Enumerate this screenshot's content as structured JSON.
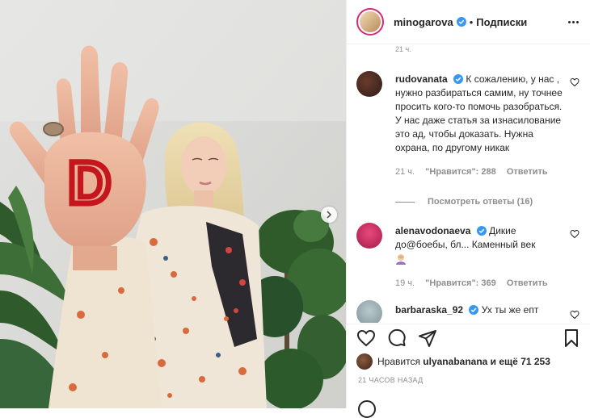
{
  "post": {
    "author": "minogarova",
    "follow_label": "Подписки",
    "separator": "•",
    "time_ago": "21 ЧАСОВ НАЗАД",
    "cut_top_time": "21 ч."
  },
  "comments": [
    {
      "user": "rudovanata",
      "verified": true,
      "text": "К сожалению, у нас , нужно разбираться самим, ну точнее просить кого-то помочь разобраться. У нас даже статья за изнасилование это ад, чтобы доказать. Нужна охрана, по другому никак",
      "time": "21 ч.",
      "likes": "\"Нравится\": 288",
      "reply_label": "Ответить",
      "replies_label": "Посмотреть ответы (16)"
    },
    {
      "user": "alenavodonaeva",
      "verified": true,
      "text": "Дикие до@боебы, бл... Каменный век",
      "time": "19 ч.",
      "likes": "\"Нравится\": 369",
      "reply_label": "Ответить"
    },
    {
      "user": "barbaraska_92",
      "verified": true,
      "text": "Ух ты же епт"
    }
  ],
  "likes_line": {
    "prefix": "Нравится",
    "user": "ulyanabanana",
    "suffix": "и ещё 71 253"
  },
  "photo": {
    "palm_letter": "D"
  },
  "icons": [
    "heart-icon",
    "comment-icon",
    "share-icon",
    "bookmark-icon",
    "more-icon",
    "chevron-right-icon",
    "verified-icon"
  ],
  "colors": {
    "verified": "#3897f0",
    "palm_letter": "#c4161c",
    "muted_text": "#8e8e8e"
  }
}
